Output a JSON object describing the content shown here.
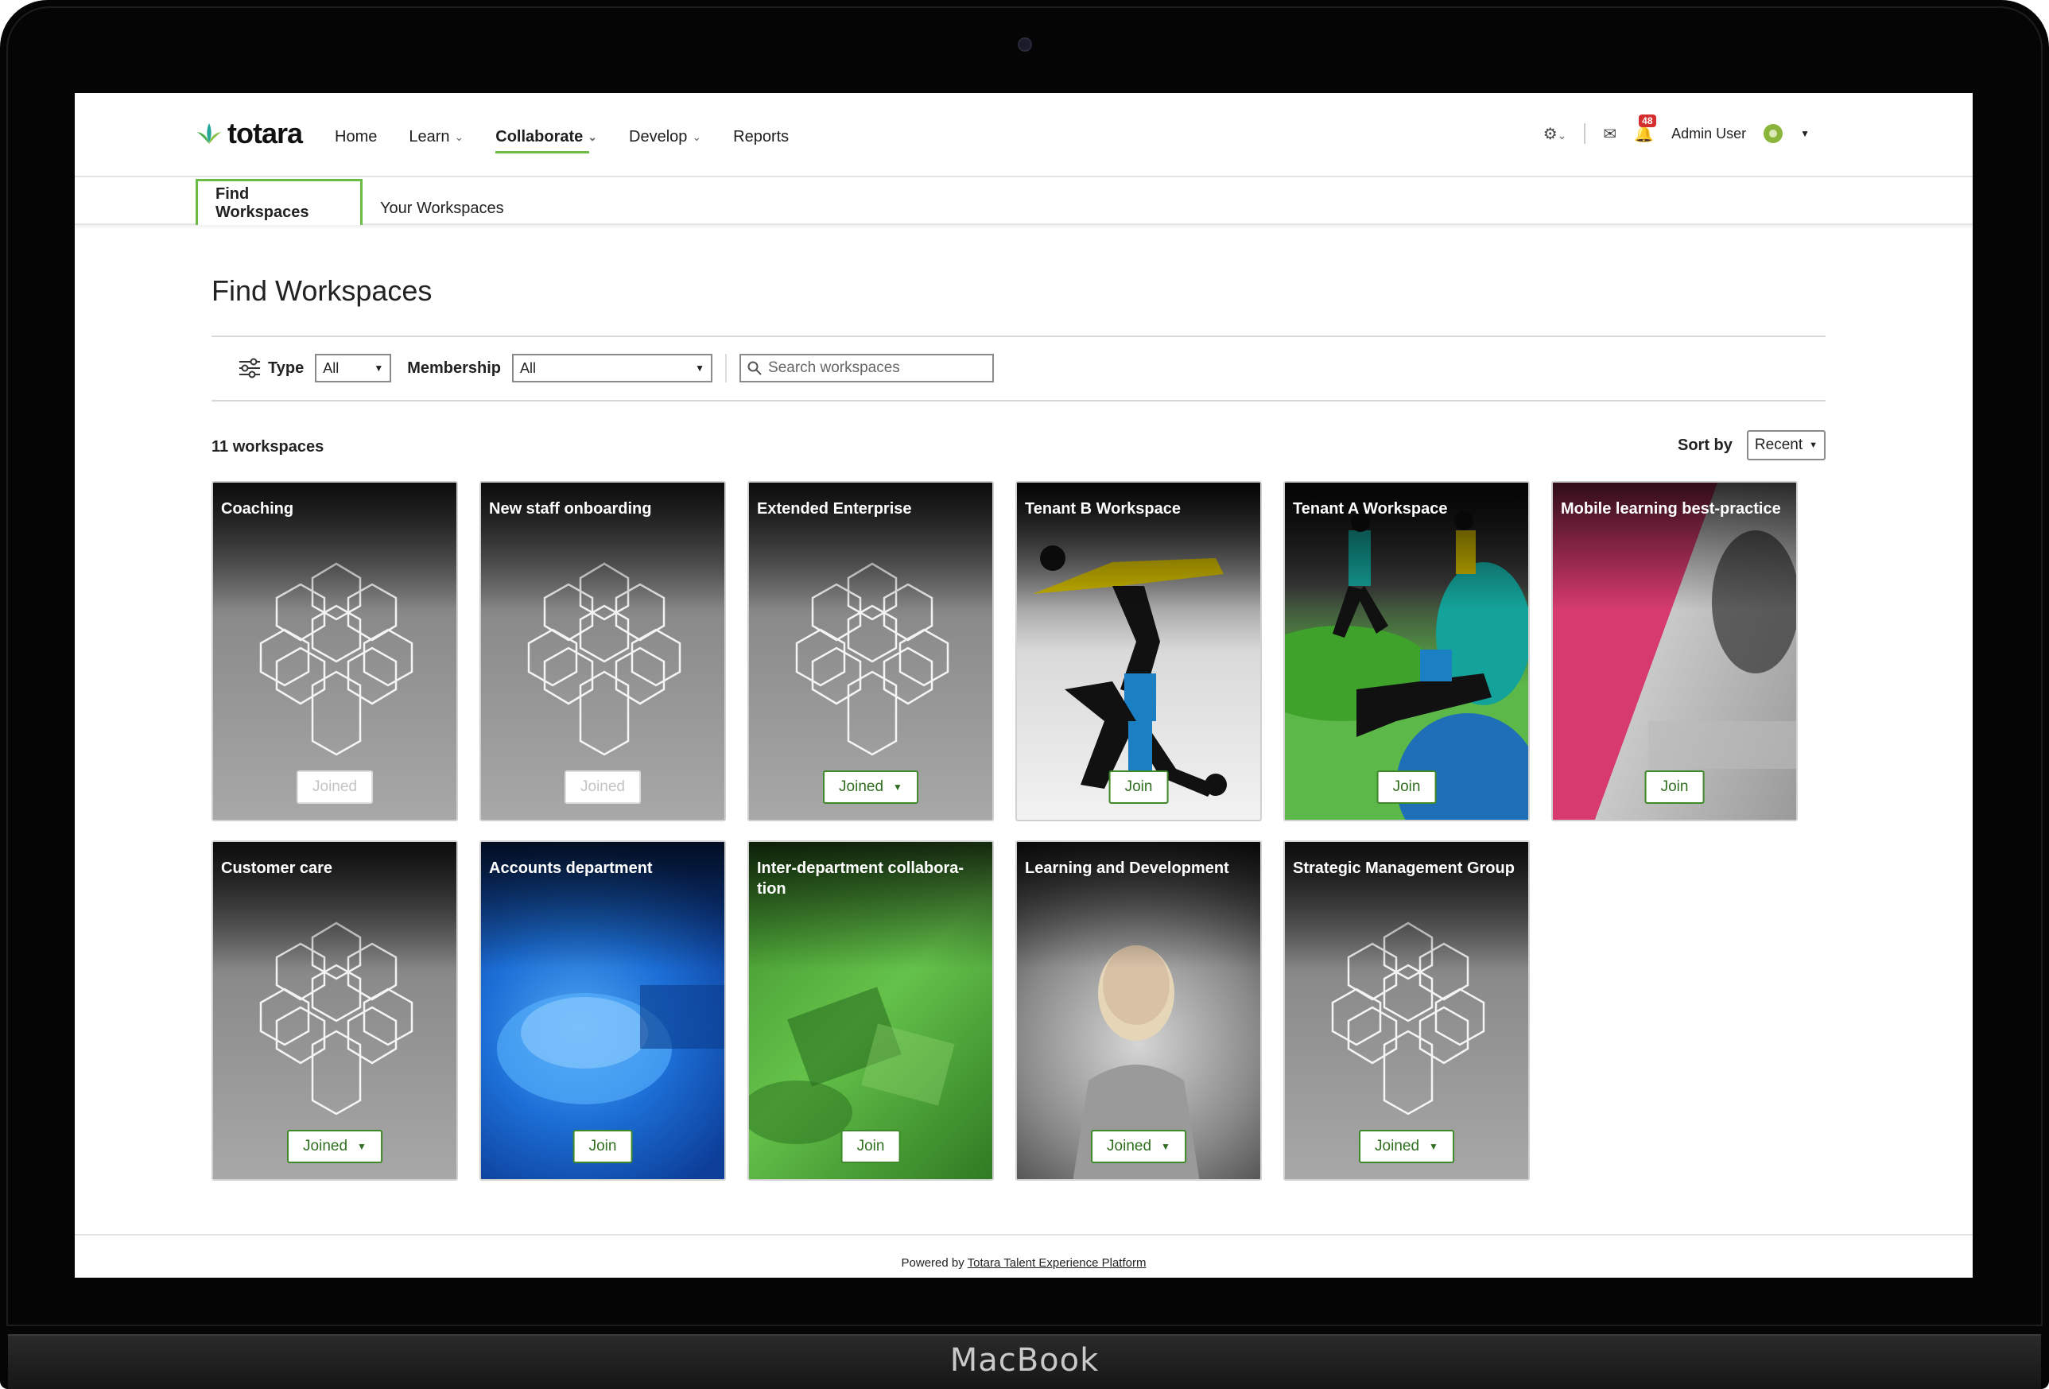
{
  "device": {
    "brand": "MacBook"
  },
  "header": {
    "logo_text": "totara",
    "nav": [
      {
        "label": "Home",
        "has_menu": false
      },
      {
        "label": "Learn",
        "has_menu": true
      },
      {
        "label": "Collaborate",
        "has_menu": true,
        "active": true
      },
      {
        "label": "Develop",
        "has_menu": true
      },
      {
        "label": "Reports",
        "has_menu": false
      }
    ],
    "notification_count": "48",
    "user_name": "Admin User"
  },
  "tabs": [
    {
      "label": "Find Workspaces",
      "active": true
    },
    {
      "label": "Your Workspaces",
      "active": false
    }
  ],
  "page": {
    "title": "Find Workspaces",
    "filters": {
      "type_label": "Type",
      "type_value": "All",
      "membership_label": "Membership",
      "membership_value": "All",
      "search_placeholder": "Search workspaces"
    },
    "count_text": "11 workspaces",
    "sort_label": "Sort by",
    "sort_value": "Recent"
  },
  "workspaces": [
    {
      "title": "Coaching",
      "button": "Joined",
      "button_state": "disabled",
      "image": "hexagon-placeholder"
    },
    {
      "title": "New staff onboarding",
      "button": "Joined",
      "button_state": "disabled",
      "image": "hexagon-placeholder"
    },
    {
      "title": "Extended Enterprise",
      "button": "Joined",
      "button_state": "dropdown",
      "image": "hexagon-placeholder"
    },
    {
      "title": "Tenant B Workspace",
      "button": "Join",
      "button_state": "action",
      "image": "illustration-acrobats"
    },
    {
      "title": "Tenant A Workspace",
      "button": "Join",
      "button_state": "action",
      "image": "illustration-helping-hands"
    },
    {
      "title": "Mobile learning best-practice",
      "button": "Join",
      "button_state": "action",
      "image": "photo-phone-pink"
    },
    {
      "title": "Customer care",
      "button": "Joined",
      "button_state": "dropdown",
      "image": "hexagon-placeholder"
    },
    {
      "title": "Accounts department",
      "button": "Join",
      "button_state": "action",
      "image": "photo-calculator-blue"
    },
    {
      "title": "Inter-department collabora-\ntion",
      "button": "Join",
      "button_state": "action",
      "image": "photo-meeting-green"
    },
    {
      "title": "Learning and Development",
      "button": "Joined",
      "button_state": "dropdown",
      "image": "photo-woman-portrait"
    },
    {
      "title": "Strategic Management Group",
      "button": "Joined",
      "button_state": "dropdown",
      "image": "hexagon-placeholder"
    }
  ],
  "footer": {
    "prefix": "Powered by",
    "link": "Totara Talent Experience Platform"
  },
  "colors": {
    "brand_green": "#69bd45",
    "button_green": "#2f6f1f",
    "badge_red": "#d32f2f"
  }
}
